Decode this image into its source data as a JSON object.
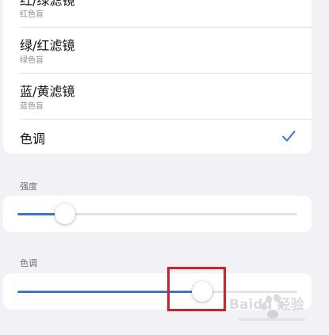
{
  "filters": [
    {
      "title": "红/绿滤镜",
      "subtitle": "红色盲"
    },
    {
      "title": "绿/红滤镜",
      "subtitle": "绿色盲"
    },
    {
      "title": "蓝/黄滤镜",
      "subtitle": "蓝色盲"
    },
    {
      "title": "色调",
      "selected": true,
      "check_icon": "checkmark-icon"
    }
  ],
  "intensity": {
    "label": "强度",
    "value_fraction": 0.17
  },
  "tint": {
    "label": "色调",
    "value_fraction": 0.66
  },
  "watermark": {
    "text": "Baidu 经验"
  },
  "colors": {
    "accent": "#3a73d6",
    "background": "#f2f2f6",
    "highlight": "#d61f26"
  }
}
